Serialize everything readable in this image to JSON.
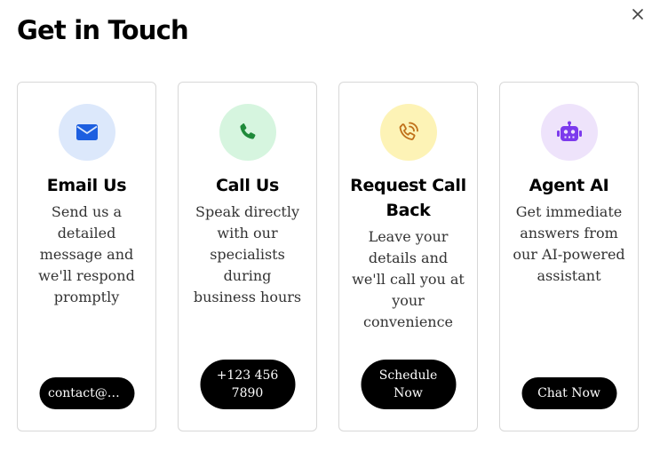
{
  "dialog": {
    "title": "Get in Touch",
    "close_icon": "close-icon"
  },
  "cards": [
    {
      "title": "Email Us",
      "description": "Send us a detailed message and we'll respond promptly",
      "button_label": "contact@b...",
      "icon": "envelope-icon",
      "icon_color": "#1d5fe0",
      "icon_bg": "#dce8fb"
    },
    {
      "title": "Call Us",
      "description": "Speak directly with our specialists during business hours",
      "button_label": "+123 456 7890",
      "icon": "phone-icon",
      "icon_color": "#1f8a3a",
      "icon_bg": "#d6f5df"
    },
    {
      "title": "Request Call Back",
      "description": "Leave your details and we'll call you at your convenience",
      "button_label": "Schedule Now",
      "icon": "phone-callback-icon",
      "icon_color": "#c0701a",
      "icon_bg": "#fdf3b6"
    },
    {
      "title": "Agent AI",
      "description": "Get immediate answers from our AI-powered assistant",
      "button_label": "Chat Now",
      "icon": "robot-icon",
      "icon_color": "#7c3aed",
      "icon_bg": "#eee3fb"
    }
  ]
}
